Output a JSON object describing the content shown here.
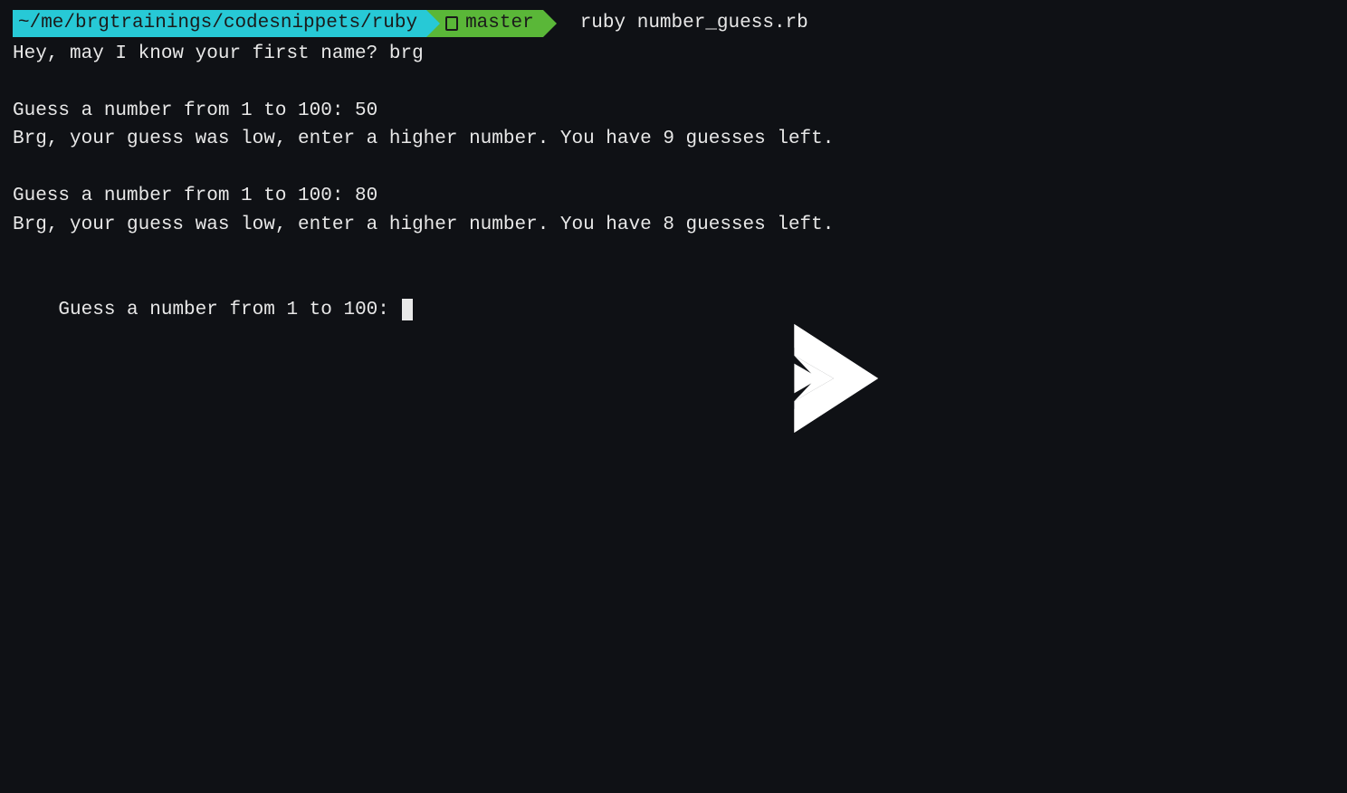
{
  "prompt": {
    "path": "~/me/brgtrainings/codesnippets/ruby",
    "branch": "master",
    "command": "ruby number_guess.rb"
  },
  "lines": {
    "l1": "Hey, may I know your first name? brg",
    "l2": "",
    "l3": "Guess a number from 1 to 100: 50",
    "l4": "Brg, your guess was low, enter a higher number. You have 9 guesses left.",
    "l5": "",
    "l6": "Guess a number from 1 to 100: 80",
    "l7": "Brg, your guess was low, enter a higher number. You have 8 guesses left.",
    "l8": "",
    "l9": "Guess a number from 1 to 100: "
  },
  "icons": {
    "play": "play"
  }
}
